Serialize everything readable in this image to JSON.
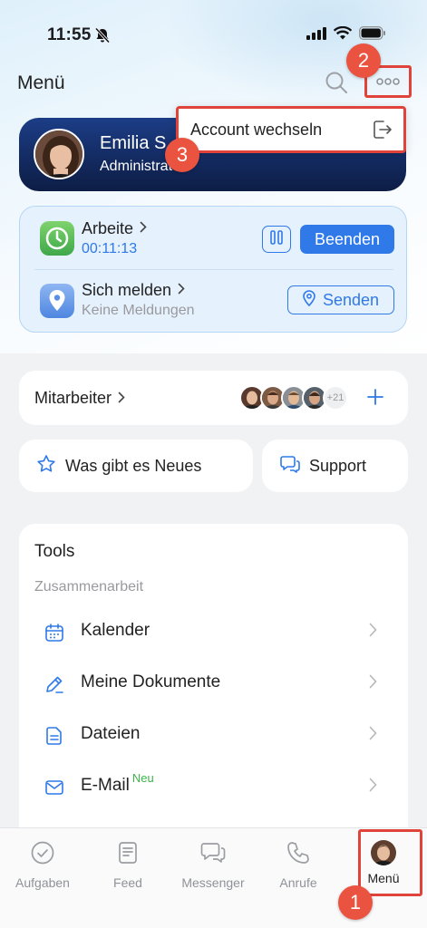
{
  "status_bar": {
    "time": "11:55"
  },
  "header": {
    "title": "Menü"
  },
  "dropdown": {
    "switch_account_label": "Account wechseln"
  },
  "profile": {
    "name": "Emilia S",
    "role": "Administrator"
  },
  "time_tracking": {
    "work_label": "Arbeite",
    "work_timer": "00:11:13",
    "end_button": "Beenden",
    "report_label": "Sich melden",
    "report_status": "Keine Meldungen",
    "send_button": "Senden"
  },
  "staff": {
    "label": "Mitarbeiter",
    "extra_count": "+21"
  },
  "quick_links": {
    "news": "Was gibt es Neues",
    "support": "Support"
  },
  "tools": {
    "title": "Tools",
    "section": "Zusammenarbeit",
    "items": [
      {
        "label": "Kalender",
        "icon": "calendar-icon"
      },
      {
        "label": "Meine Dokumente",
        "icon": "pen-icon"
      },
      {
        "label": "Dateien",
        "icon": "file-icon"
      },
      {
        "label": "E-Mail",
        "icon": "mail-icon",
        "badge": "Neu"
      }
    ]
  },
  "bottom_nav": {
    "items": [
      {
        "label": "Aufgaben",
        "icon": "check-circle-icon"
      },
      {
        "label": "Feed",
        "icon": "feed-icon"
      },
      {
        "label": "Messenger",
        "icon": "chat-icon"
      },
      {
        "label": "Anrufe",
        "icon": "phone-icon"
      },
      {
        "label": "Menü",
        "icon": "avatar-icon",
        "active": true
      }
    ]
  },
  "annotations": {
    "step1": "1",
    "step2": "2",
    "step3": "3"
  },
  "colors": {
    "accent": "#2f79e8",
    "annotation": "#e0433a",
    "profile_card": "#112a63",
    "badge_new": "#3cb54a"
  }
}
